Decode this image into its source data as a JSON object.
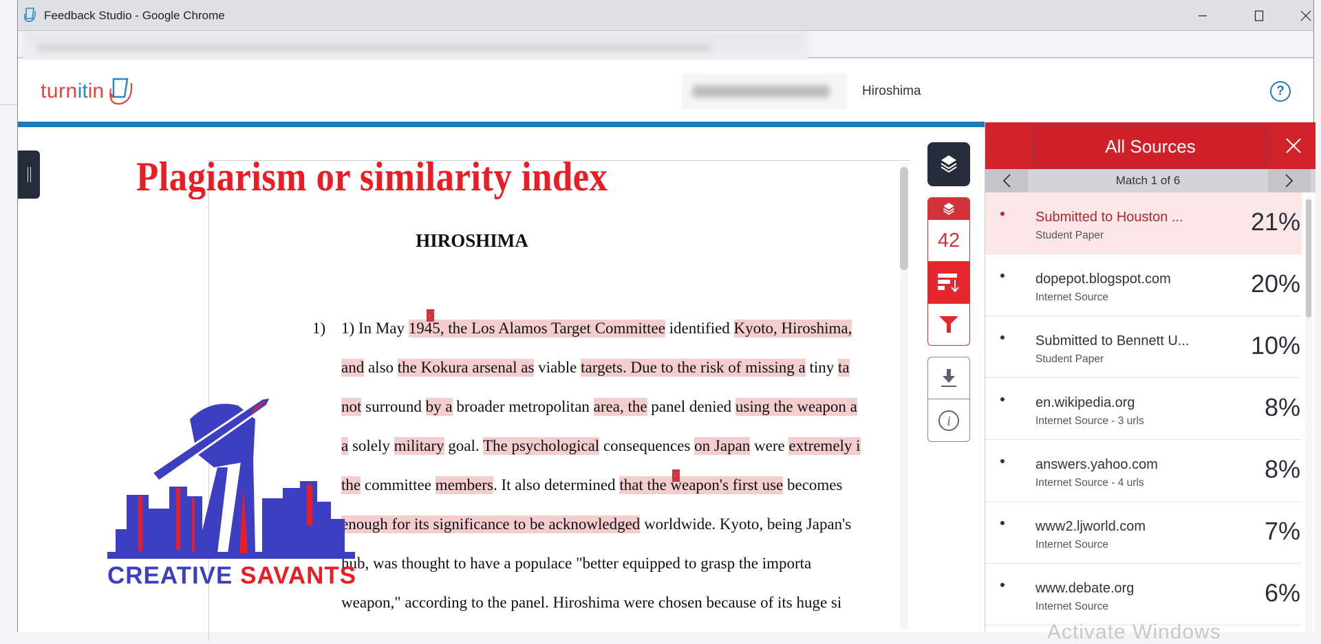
{
  "window": {
    "title": "Feedback Studio - Google Chrome",
    "minimize_icon": "minimize-icon",
    "maximize_icon": "maximize-icon",
    "close_icon": "close-icon"
  },
  "header": {
    "logo": {
      "part1": "turn",
      "part2": "it",
      "part3": "in"
    },
    "paper_title": "Hiroshima",
    "help_label": "?"
  },
  "overlay": {
    "title": "Plagiarism or similarity index",
    "brand_part1": "CREATIVE",
    "brand_part2": "SAVANTS"
  },
  "document": {
    "heading": "HIROSHIMA",
    "list_number": "1)",
    "lines": [
      [
        {
          "t": "1) In May ",
          "h": false
        },
        {
          "t": "1945, the Los Alamos Target Committee",
          "h": true
        },
        {
          "t": " identified ",
          "h": false
        },
        {
          "t": "Kyoto, Hiroshima,",
          "h": true
        }
      ],
      [
        {
          "t": "and",
          "h": true
        },
        {
          "t": " also ",
          "h": false
        },
        {
          "t": "the Kokura arsenal as",
          "h": true
        },
        {
          "t": " viable ",
          "h": false
        },
        {
          "t": "targets. Due to the risk of missing a",
          "h": true
        },
        {
          "t": " tiny ",
          "h": false
        },
        {
          "t": "ta",
          "h": true
        }
      ],
      [
        {
          "t": "not",
          "h": true
        },
        {
          "t": " surround ",
          "h": false
        },
        {
          "t": "by a",
          "h": true
        },
        {
          "t": " broader metropolitan ",
          "h": false
        },
        {
          "t": "area, the",
          "h": true
        },
        {
          "t": " panel denied ",
          "h": false
        },
        {
          "t": "using the weapon a",
          "h": true
        }
      ],
      [
        {
          "t": "a",
          "h": true
        },
        {
          "t": " solely ",
          "h": false
        },
        {
          "t": "military",
          "h": true
        },
        {
          "t": " goal. ",
          "h": false
        },
        {
          "t": "The psychological",
          "h": true
        },
        {
          "t": " consequences ",
          "h": false
        },
        {
          "t": "on Japan",
          "h": true
        },
        {
          "t": " were ",
          "h": false
        },
        {
          "t": "extremely i",
          "h": true
        }
      ],
      [
        {
          "t": "the",
          "h": true
        },
        {
          "t": " committee ",
          "h": false
        },
        {
          "t": "members",
          "h": true
        },
        {
          "t": ". It also determined ",
          "h": false
        },
        {
          "t": "that the weapon's first use",
          "h": true
        },
        {
          "t": " becomes",
          "h": false
        }
      ],
      [
        {
          "t": "enough for its significance to be acknowledged",
          "h": true
        },
        {
          "t": " worldwide. Kyoto, being Japan's",
          "h": false
        }
      ],
      [
        {
          "t": "hub, was thought to have a populace \"better equipped to grasp the importa",
          "h": false
        }
      ],
      [
        {
          "t": "weapon,\" according to the panel. Hiroshima were chosen because of its huge si",
          "h": false
        }
      ]
    ]
  },
  "toolbar": {
    "match_count": "42",
    "layers_icon": "layers-icon",
    "sort_icon": "sort-icon",
    "filter_icon": "filter-icon",
    "download_icon": "download-icon",
    "info_icon": "info-icon"
  },
  "panel": {
    "title": "All Sources",
    "match_label": "Match 1 of 6",
    "sources": [
      {
        "name": "Submitted to Houston ...",
        "type": "Student Paper",
        "percent": "21%",
        "active": true
      },
      {
        "name": "dopepot.blogspot.com",
        "type": "Internet Source",
        "percent": "20%",
        "active": false
      },
      {
        "name": "Submitted to Bennett U...",
        "type": "Student Paper",
        "percent": "10%",
        "active": false
      },
      {
        "name": "en.wikipedia.org",
        "type": "Internet Source - 3 urls",
        "percent": "8%",
        "active": false
      },
      {
        "name": "answers.yahoo.com",
        "type": "Internet Source - 4 urls",
        "percent": "8%",
        "active": false
      },
      {
        "name": "www2.ljworld.com",
        "type": "Internet Source",
        "percent": "7%",
        "active": false
      },
      {
        "name": "www.debate.org",
        "type": "Internet Source",
        "percent": "6%",
        "active": false
      }
    ],
    "watermark": "Activate Windows"
  },
  "colors": {
    "turnitin_red": "#e0463a",
    "turnitin_blue": "#2378b6",
    "panel_red": "#d2232a",
    "highlight": "#f4cdcf",
    "toolbar_dark": "#252c3c"
  }
}
